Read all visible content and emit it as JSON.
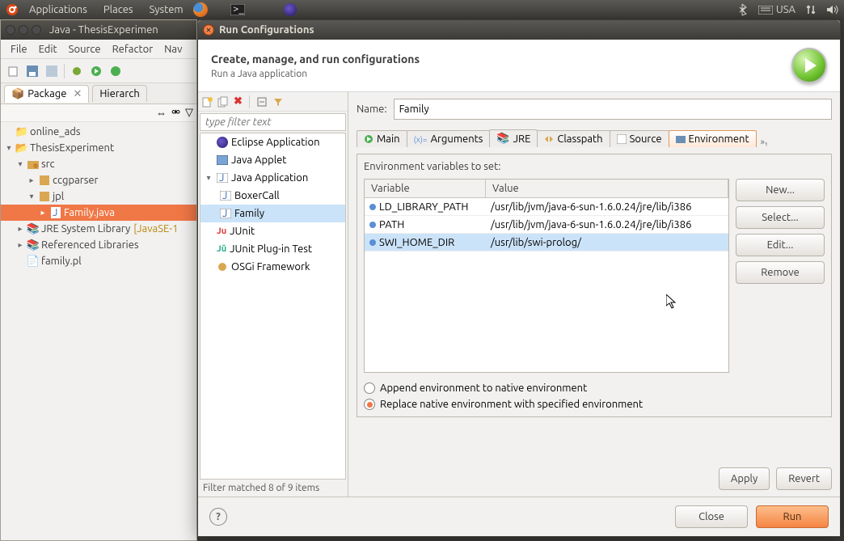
{
  "topbar": {
    "menus": [
      "Applications",
      "Places",
      "System"
    ],
    "keyboard": "USA"
  },
  "eclipse": {
    "title": "Java - ThesisExperimen",
    "menus": [
      "File",
      "Edit",
      "Source",
      "Refactor",
      "Nav"
    ],
    "tabs": {
      "package": "Package",
      "hierarchy": "Hierarch"
    },
    "tree": {
      "online_ads": "online_ads",
      "project": "ThesisExperiment",
      "src": "src",
      "ccgparser": "ccgparser",
      "jpl": "jpl",
      "family_java": "Family.java",
      "jre": "JRE System Library",
      "jre_suffix": "[JavaSE-1",
      "ref_libs": "Referenced Libraries",
      "family_pl": "family.pl"
    }
  },
  "dialog": {
    "title": "Run Configurations",
    "heading": "Create, manage, and run configurations",
    "subheading": "Run a Java application",
    "filter_placeholder": "type filter text",
    "config_types": {
      "eclipse_app": "Eclipse Application",
      "java_applet": "Java Applet",
      "java_app": "Java Application",
      "boxercall": "BoxerCall",
      "family": "Family",
      "junit": "JUnit",
      "junit_plugin": "JUnit Plug-in Test",
      "osgi": "OSGi Framework"
    },
    "filter_status": "Filter matched 8 of 9 items",
    "name_label": "Name:",
    "name_value": "Family",
    "tabs": [
      "Main",
      "Arguments",
      "JRE",
      "Classpath",
      "Source",
      "Environment"
    ],
    "env": {
      "label": "Environment variables to set:",
      "columns": {
        "var": "Variable",
        "val": "Value"
      },
      "rows": [
        {
          "var": "LD_LIBRARY_PATH",
          "val": "/usr/lib/jvm/java-6-sun-1.6.0.24/jre/lib/i386"
        },
        {
          "var": "PATH",
          "val": "/usr/lib/jvm/java-6-sun-1.6.0.24/jre/lib/i386"
        },
        {
          "var": "SWI_HOME_DIR",
          "val": "/usr/lib/swi-prolog/"
        }
      ],
      "buttons": {
        "new": "New...",
        "select": "Select...",
        "edit": "Edit...",
        "remove": "Remove"
      },
      "radio_append": "Append environment to native environment",
      "radio_replace": "Replace native environment with specified environment"
    },
    "apply": "Apply",
    "revert": "Revert",
    "close": "Close",
    "run": "Run"
  }
}
